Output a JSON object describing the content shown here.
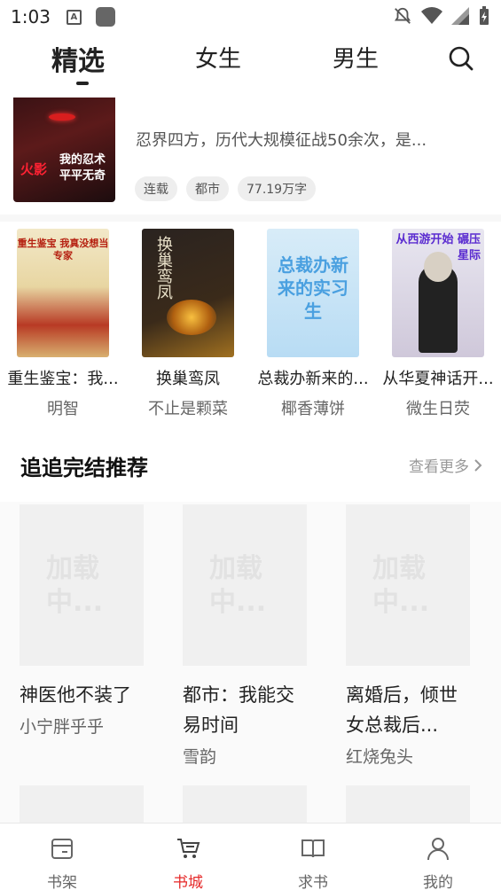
{
  "status_bar": {
    "time": "1:03",
    "a_icon_letter": "A"
  },
  "top_nav": {
    "tabs": [
      {
        "label": "精选",
        "active": true
      },
      {
        "label": "女生",
        "active": false
      },
      {
        "label": "男生",
        "active": false
      }
    ]
  },
  "featured_book": {
    "cover_brand": "火影",
    "cover_title": "我的忍术平平无奇",
    "description": "忍界四方，历代大规模征战50余次，是...",
    "tags": [
      "连载",
      "都市",
      "77.19万字"
    ]
  },
  "book_row": [
    {
      "title": "重生鉴宝：我...",
      "author": "明智",
      "cover_text": "重生鉴宝 我真没想当专家"
    },
    {
      "title": "换巢鸾凤",
      "author": "不止是颗菜",
      "cover_text": "换巢鸾凤"
    },
    {
      "title": "总裁办新来的...",
      "author": "椰香薄饼",
      "cover_text": "总裁办新来的实习生"
    },
    {
      "title": "从华夏神话开...",
      "author": "微生日荧",
      "cover_text": "从西游开始 碾压星际"
    }
  ],
  "section": {
    "title": "追追完结推荐",
    "more_label": "查看更多"
  },
  "grid_books": [
    {
      "title": "神医他不装了",
      "author": "小宁胖乎乎",
      "loading_text": "加载中..."
    },
    {
      "title": "都市：我能交易时间",
      "author": "雪韵",
      "loading_text": "加载中..."
    },
    {
      "title": "离婚后，倾世女总裁后...",
      "author": "红烧兔头",
      "loading_text": "加载中..."
    }
  ],
  "bottom_nav": [
    {
      "label": "书架",
      "icon": "bookshelf-icon"
    },
    {
      "label": "书城",
      "icon": "bookstore-cart-icon",
      "active": true
    },
    {
      "label": "求书",
      "icon": "open-book-icon"
    },
    {
      "label": "我的",
      "icon": "person-icon"
    }
  ],
  "colors": {
    "accent": "#e52828",
    "text": "#222222",
    "muted": "#666666"
  }
}
